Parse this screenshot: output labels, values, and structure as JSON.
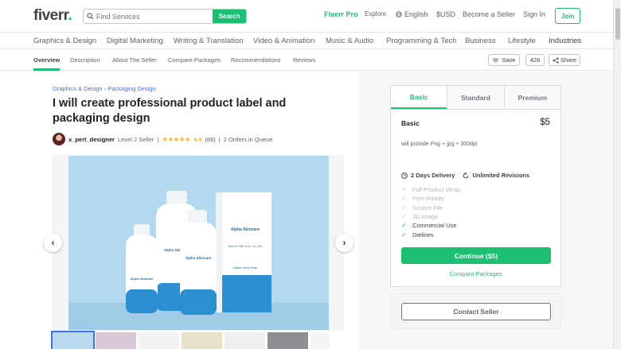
{
  "header": {
    "logo": "fiverr",
    "logo_dot": ".",
    "search_placeholder": "Find Services",
    "search_button": "Search",
    "fiverr_pro": "Fiverr Pro",
    "explore": "Explore",
    "language": "English",
    "currency": "$USD",
    "become_seller": "Become a Seller",
    "sign_in": "Sign In",
    "join": "Join"
  },
  "categories": [
    "Graphics & Design",
    "Digital Marketing",
    "Writing & Translation",
    "Video & Animation",
    "Music & Audio",
    "Programming & Tech",
    "Business",
    "Lifestyle",
    "Industries"
  ],
  "subnav": {
    "items": [
      "Overview",
      "Description",
      "About The Seller",
      "Compare Packages",
      "Recommendations",
      "Reviews"
    ],
    "save": "Save",
    "save_count": "426",
    "share": "Share"
  },
  "gig": {
    "breadcrumb": [
      "Graphics & Design",
      "Packaging Design"
    ],
    "breadcrumb_sep": "›",
    "title": "I will create professional product label and packaging design",
    "seller_name": "x_pert_designer",
    "seller_level": "Level 2 Seller",
    "stars": "★★★★★",
    "rating": "4.9",
    "reviews": "(88)",
    "divider": "|",
    "queue": "2 Orders in Queue"
  },
  "image": {
    "brand": "Alpha Skincare",
    "tagline": "Natural Gifts From The Nile",
    "product": "Organic Body Wash"
  },
  "package": {
    "tabs": [
      "Basic",
      "Standard",
      "Premium"
    ],
    "active_tab": "Basic",
    "name": "Basic",
    "price": "$5",
    "description": "will provide Png + jpg + 300dpi",
    "delivery": "2 Days Delivery",
    "revisions": "Unlimited Revisions",
    "features": [
      {
        "label": "Full Product Wrap",
        "included": false
      },
      {
        "label": "Print-Ready",
        "included": false
      },
      {
        "label": "Source File",
        "included": false
      },
      {
        "label": "3D Image",
        "included": false
      },
      {
        "label": "Commercial Use",
        "included": true
      },
      {
        "label": "Dielines",
        "included": true
      }
    ],
    "continue": "Continue ($5)",
    "compare": "Compare Packages",
    "contact": "Contact Seller"
  },
  "colors": {
    "brand_green": "#1dbf73",
    "link_blue": "#446ee7",
    "star": "#ffb33e"
  }
}
